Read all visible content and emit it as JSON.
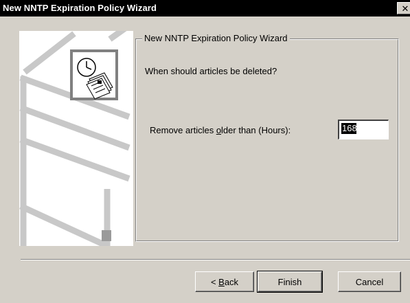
{
  "window": {
    "title": "New NNTP Expiration Policy Wizard",
    "close_glyph": "✕"
  },
  "groupbox": {
    "legend": "New NNTP Expiration Policy Wizard"
  },
  "content": {
    "question": "When should articles be deleted?",
    "field_label_pre": "Remove articles ",
    "field_label_accel": "o",
    "field_label_post": "lder than (Hours):",
    "hours_value": "168"
  },
  "buttons": {
    "back_pre": "< ",
    "back_accel": "B",
    "back_post": "ack",
    "finish": "Finish",
    "cancel": "Cancel"
  },
  "icons": {
    "art": "server-wizard-illustration",
    "clock": "clock-icon",
    "articles": "news-articles-icon"
  }
}
